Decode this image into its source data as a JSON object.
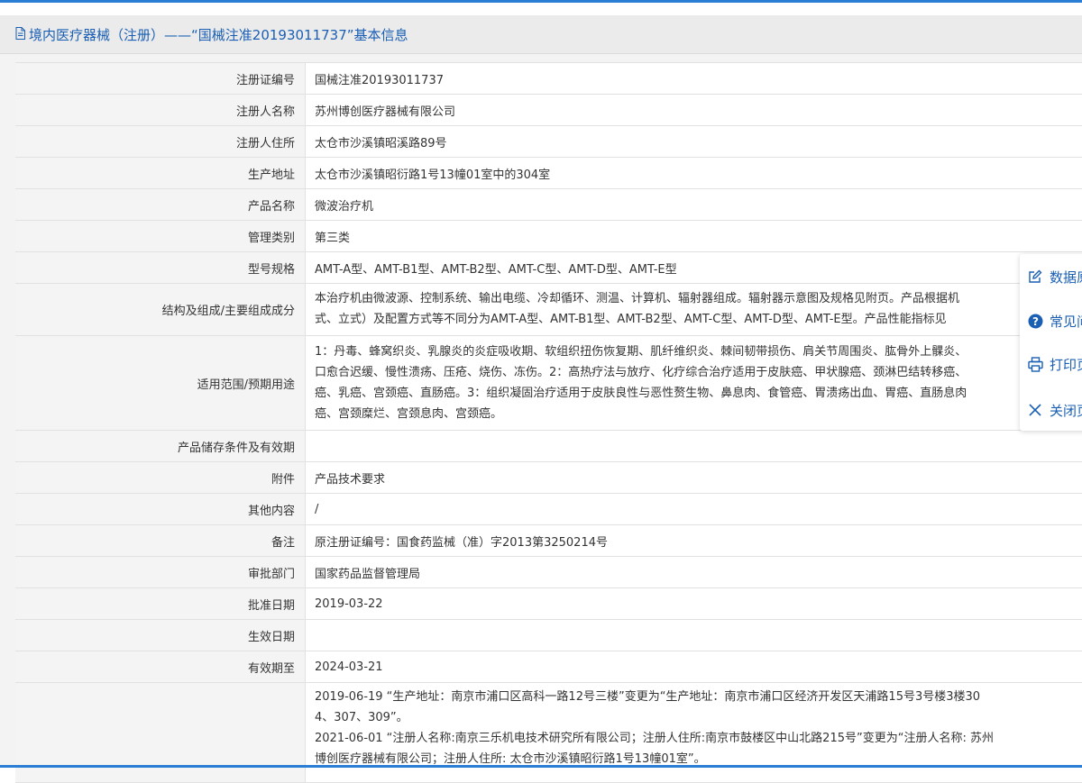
{
  "header": {
    "title": "境内医疗器械（注册）——“国械注准20193011737”基本信息"
  },
  "rows": [
    {
      "label": "注册证编号",
      "value": "国械注准20193011737"
    },
    {
      "label": "注册人名称",
      "value": "苏州博创医疗器械有限公司"
    },
    {
      "label": "注册人住所",
      "value": "太仓市沙溪镇昭溪路89号"
    },
    {
      "label": "生产地址",
      "value": "太仓市沙溪镇昭衍路1号13幢01室中的304室"
    },
    {
      "label": "产品名称",
      "value": "微波治疗机"
    },
    {
      "label": "管理类别",
      "value": "第三类"
    },
    {
      "label": "型号规格",
      "value": "AMT-A型、AMT-B1型、AMT-B2型、AMT-C型、AMT-D型、AMT-E型"
    },
    {
      "label": "结构及组成/主要组成成分",
      "lines": [
        "本治疗机由微波源、控制系统、输出电缆、冷却循环、测温、计算机、辐射器组成。辐射器示意图及规格见附页。产品根据机",
        "式、立式）及配置方式等不同分为AMT-A型、AMT-B1型、AMT-B2型、AMT-C型、AMT-D型、AMT-E型。产品性能指标见"
      ]
    },
    {
      "label": "适用范围/预期用途",
      "lines": [
        "1：丹毒、蜂窝织炎、乳腺炎的炎症吸收期、软组织扭伤恢复期、肌纤维织炎、棘间韧带损伤、肩关节周围炎、肱骨外上髁炎、",
        "口愈合迟缓、慢性溃疡、压疮、烧伤、冻伤。2：高热疗法与放疗、化疗综合治疗适用于皮肤癌、甲状腺癌、颈淋巴结转移癌、",
        "癌、乳癌、宫颈癌、直肠癌。3：组织凝固治疗适用于皮肤良性与恶性赘生物、鼻息肉、食管癌、胃溃疡出血、胃癌、直肠息肉",
        "癌、宫颈糜烂、宫颈息肉、宫颈癌。"
      ]
    },
    {
      "label": "产品储存条件及有效期",
      "value": ""
    },
    {
      "label": "附件",
      "value": "产品技术要求"
    },
    {
      "label": "其他内容",
      "value": "/"
    },
    {
      "label": "备注",
      "value": "原注册证编号：国食药监械（准）字2013第3250214号"
    },
    {
      "label": "审批部门",
      "value": "国家药品监督管理局"
    },
    {
      "label": "批准日期",
      "value": "2019-03-22"
    },
    {
      "label": "生效日期",
      "value": ""
    },
    {
      "label": "有效期至",
      "value": "2024-03-21"
    },
    {
      "label": "",
      "lines": [
        "2019-06-19 “生产地址：南京市浦口区高科一路12号三楼”变更为“生产地址：南京市浦口区经济开发区天浦路15号3号楼3楼30",
        "4、307、309”。",
        "2021-06-01 “注册人名称:南京三乐机电技术研究所有限公司；注册人住所:南京市鼓楼区中山北路215号”变更为“注册人名称: 苏州",
        "博创医疗器械有限公司；注册人住所: 太仓市沙溪镇昭衍路1号13幢01室”。"
      ]
    }
  ],
  "floating_menu": {
    "items": [
      {
        "label": "数据原",
        "icon": "edit-icon"
      },
      {
        "label": "常见问",
        "icon": "help-icon"
      },
      {
        "label": "打印页",
        "icon": "print-icon"
      },
      {
        "label": "关闭页",
        "icon": "close-icon"
      }
    ]
  }
}
